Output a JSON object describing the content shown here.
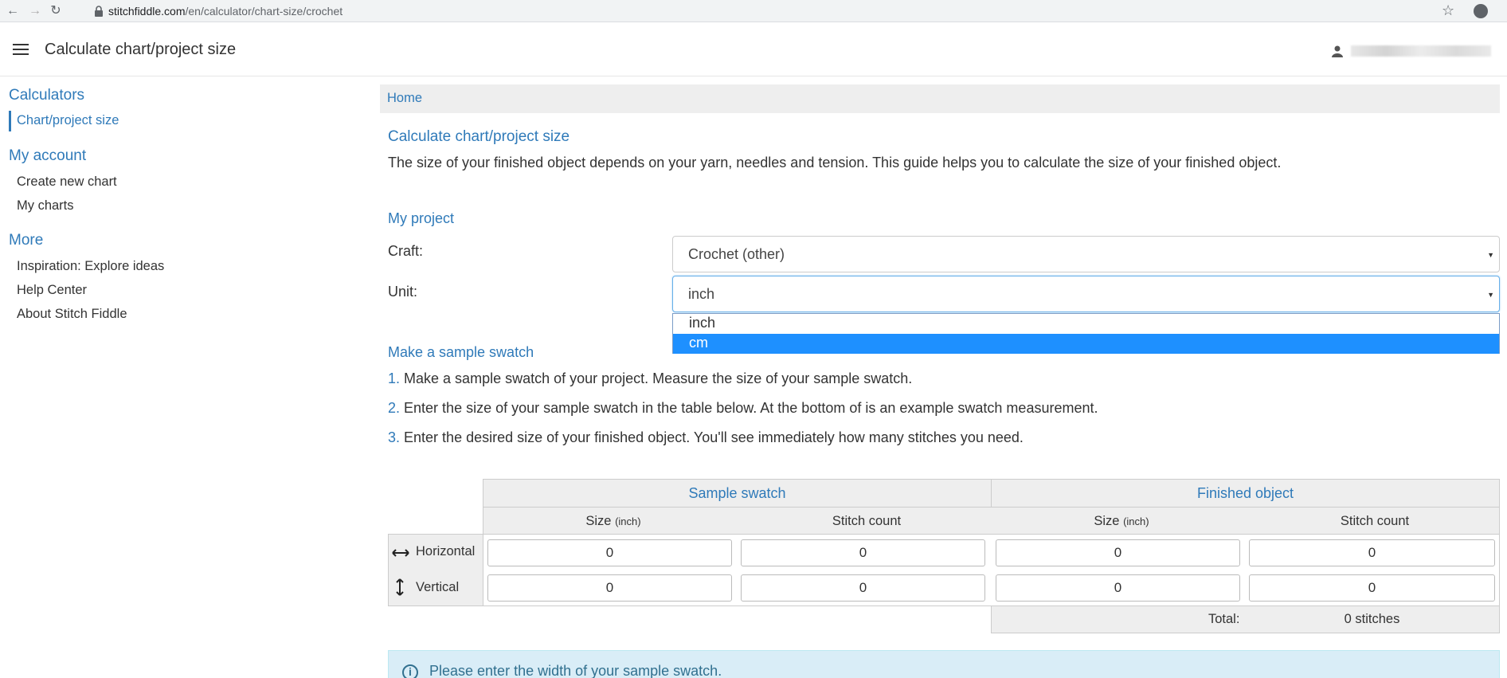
{
  "browser": {
    "url_host": "stitchfiddle.com",
    "url_path": "/en/calculator/chart-size/crochet"
  },
  "header": {
    "title": "Calculate chart/project size"
  },
  "sidebar": {
    "sections": [
      {
        "heading": "Calculators",
        "items": [
          "Chart/project size"
        ]
      },
      {
        "heading": "My account",
        "items": [
          "Create new chart",
          "My charts"
        ]
      },
      {
        "heading": "More",
        "items": [
          "Inspiration: Explore ideas",
          "Help Center",
          "About Stitch Fiddle"
        ]
      }
    ]
  },
  "breadcrumb": {
    "home": "Home"
  },
  "main": {
    "title": "Calculate chart/project size",
    "intro": "The size of your finished object depends on your yarn, needles and tension. This guide helps you to calculate the size of your finished object.",
    "project_heading": "My project",
    "craft_label": "Craft:",
    "craft_value": "Crochet (other)",
    "unit_label": "Unit:",
    "unit_value": "inch",
    "unit_options": [
      "inch",
      "cm"
    ],
    "unit_highlighted": "cm",
    "swatch_heading": "Make a sample swatch",
    "steps": [
      {
        "num": "1.",
        "text": "Make a sample swatch of your project. Measure the size of your sample swatch."
      },
      {
        "num": "2.",
        "text": "Enter the size of your sample swatch in the table below. At the bottom of is an example swatch measurement."
      },
      {
        "num": "3.",
        "text": "Enter the desired size of your finished object. You'll see immediately how many stitches you need."
      }
    ]
  },
  "table": {
    "group_sample": "Sample swatch",
    "group_finished": "Finished object",
    "col_size": "Size",
    "col_size_unit": "(inch)",
    "col_count": "Stitch count",
    "rows": [
      {
        "label": "Horizontal",
        "values": [
          "0",
          "0",
          "0",
          "0"
        ]
      },
      {
        "label": "Vertical",
        "values": [
          "0",
          "0",
          "0",
          "0"
        ]
      }
    ],
    "total_label": "Total:",
    "total_value": "0 stitches"
  },
  "alert": {
    "message": "Please enter the width of your sample swatch."
  }
}
